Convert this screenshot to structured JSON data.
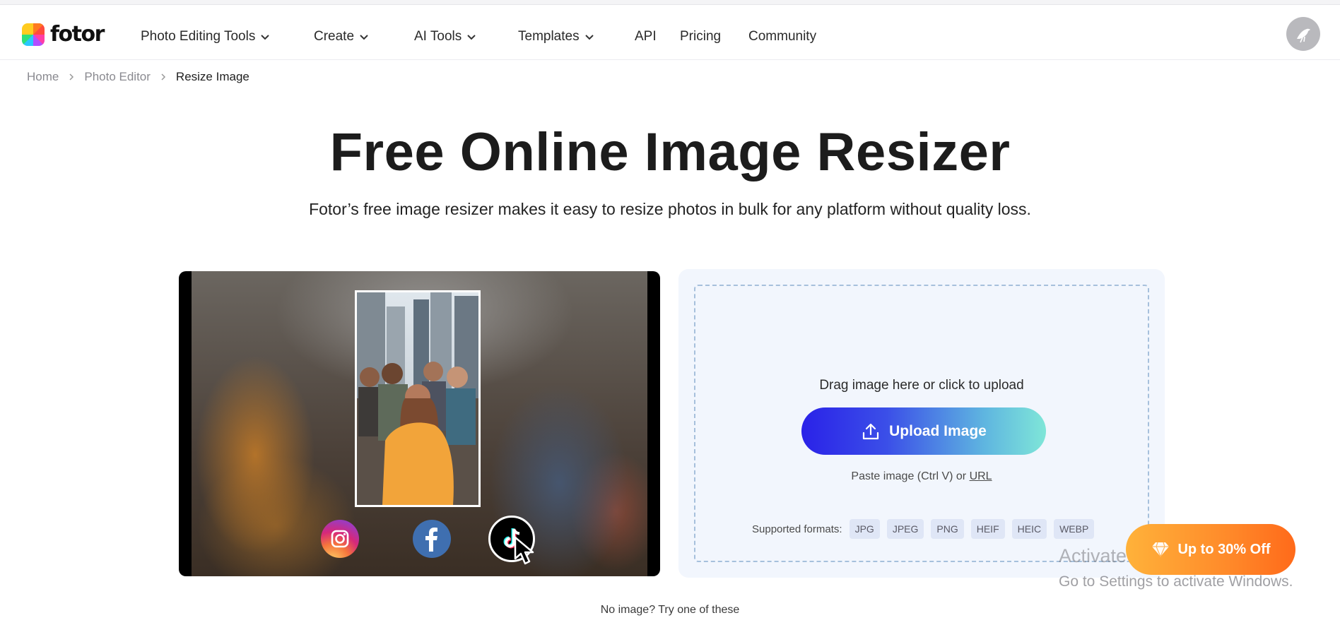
{
  "header": {
    "logo_text": "fotor",
    "nav": [
      {
        "label": "Photo Editing Tools",
        "has_dropdown": true
      },
      {
        "label": "Create",
        "has_dropdown": true
      },
      {
        "label": "AI Tools",
        "has_dropdown": true
      },
      {
        "label": "Templates",
        "has_dropdown": true
      },
      {
        "label": "API",
        "has_dropdown": false
      },
      {
        "label": "Pricing",
        "has_dropdown": false
      },
      {
        "label": "Community",
        "has_dropdown": false
      }
    ],
    "avatar_icon": "bird-avatar-icon"
  },
  "breadcrumb": {
    "items": [
      "Home",
      "Photo Editor",
      "Resize Image"
    ]
  },
  "hero": {
    "title": "Free Online Image Resizer",
    "subtitle": "Fotor’s free image resizer makes it easy to resize photos in bulk for any platform without quality loss."
  },
  "preview": {
    "social_icons": [
      "instagram-icon",
      "facebook-icon",
      "tiktok-icon"
    ],
    "cursor_icon": "cursor-arrow-icon"
  },
  "upload": {
    "drag_text": "Drag image here or click to upload",
    "button_label": "Upload Image",
    "paste_prefix": "Paste image (Ctrl V) or ",
    "paste_link": "URL",
    "formats_label": "Supported formats:",
    "formats": [
      "JPG",
      "JPEG",
      "PNG",
      "HEIF",
      "HEIC",
      "WEBP"
    ]
  },
  "promo": {
    "label": "Up to 30% Off",
    "icon": "diamond-icon"
  },
  "watermark": {
    "line1": "Activate Windows",
    "line2": "Go to Settings to activate Windows."
  },
  "footer_hint": "No image? Try one of these",
  "colors": {
    "upload_gradient_start": "#2a22e8",
    "upload_gradient_end": "#7fe6d8",
    "promo_orange": "#ff8a2a",
    "upload_panel_bg": "#f2f6fd"
  }
}
